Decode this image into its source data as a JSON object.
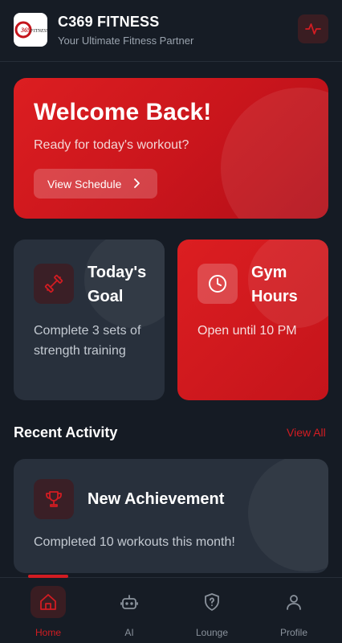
{
  "header": {
    "logo_text": "C369 FITNESS",
    "title": "C369 FITNESS",
    "subtitle": "Your Ultimate Fitness Partner",
    "action_icon": "activity-pulse-icon"
  },
  "welcome": {
    "title": "Welcome Back!",
    "subtitle": "Ready for today's workout?",
    "button_label": "View Schedule"
  },
  "cards": {
    "goal": {
      "title": "Today's Goal",
      "description": "Complete 3 sets of strength training",
      "icon": "dumbbell-icon"
    },
    "hours": {
      "title": "Gym Hours",
      "description": "Open until 10 PM",
      "icon": "clock-icon"
    }
  },
  "recent": {
    "section_title": "Recent Activity",
    "view_all_label": "View All",
    "items": [
      {
        "title": "New Achievement",
        "description": "Completed 10 workouts this month!",
        "icon": "trophy-icon"
      }
    ]
  },
  "nav": {
    "items": [
      {
        "label": "Home",
        "icon": "home-icon",
        "active": true
      },
      {
        "label": "AI",
        "icon": "robot-icon",
        "active": false
      },
      {
        "label": "Lounge",
        "icon": "shield-question-icon",
        "active": false
      },
      {
        "label": "Profile",
        "icon": "user-icon",
        "active": false
      }
    ]
  },
  "colors": {
    "accent": "#d21c22",
    "background": "#151b24",
    "card": "#28303c"
  }
}
